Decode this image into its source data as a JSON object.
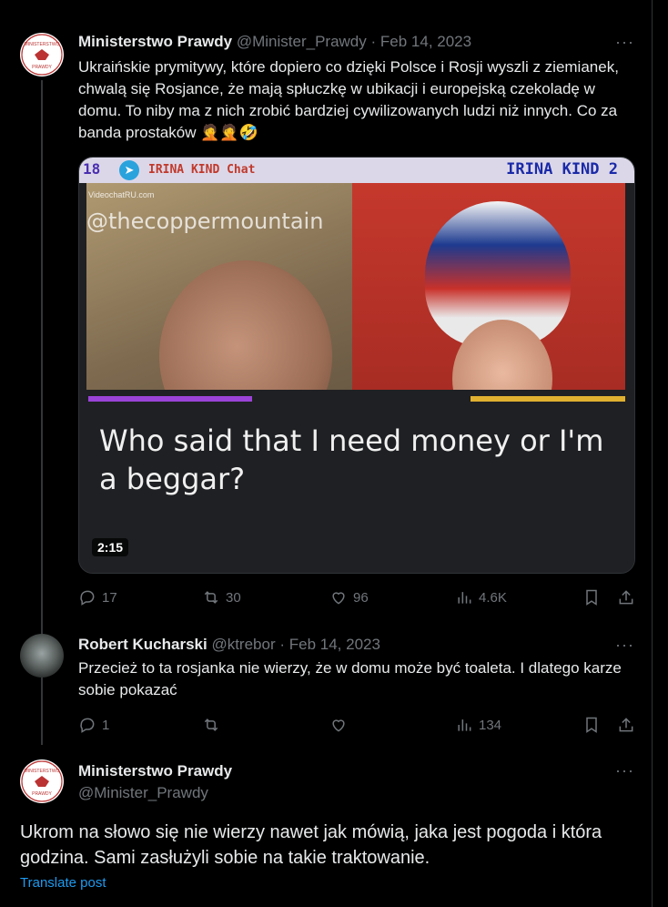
{
  "tweet1": {
    "author": "Ministerstwo Prawdy",
    "handle": "@Minister_Prawdy",
    "date": "Feb 14, 2023",
    "text": "Ukraińskie prymitywy, które dopiero co dzięki Polsce i Rosji wyszli z ziemianek, chwalą się Rosjance, że mają spłuczkę w ubikacji i europejską czekoladę w domu. To niby ma z nich zrobić bardziej cywilizowanych ludzi niż innych. Co za banda prostaków 🤦🤦🤣",
    "media": {
      "top_left_number": "18",
      "chat_title": "IRINA KIND Chat",
      "right_title": "IRINA KIND 2",
      "site_logo": "VideochatRU.com",
      "watermark": "@thecoppermountain",
      "caption": "Who said that I need money or I'm a beggar?",
      "duration": "2:15"
    },
    "stats": {
      "replies": "17",
      "reposts": "30",
      "likes": "96",
      "views": "4.6K"
    }
  },
  "tweet2": {
    "author": "Robert Kucharski",
    "handle": "@ktrebor",
    "date": "Feb 14, 2023",
    "text": "Przecież to ta rosjanka nie wierzy, że w domu może być toaleta. I dlatego karze sobie pokazać",
    "stats": {
      "replies": "1",
      "reposts": "",
      "likes": "",
      "views": "134"
    }
  },
  "tweet3": {
    "author": "Ministerstwo Prawdy",
    "handle": "@Minister_Prawdy",
    "text": "Ukrom na słowo się nie wierzy nawet jak mówią, jaka jest pogoda i która godzina. Sami zasłużyli sobie na takie traktowanie.",
    "translate": "Translate post"
  },
  "more_label": "···",
  "logo_text": "MINISTERSTWO PRAWDY",
  "colors": {
    "background": "#000000",
    "text": "#e7e9ea",
    "muted": "#71767b",
    "link": "#1d9bf0"
  }
}
